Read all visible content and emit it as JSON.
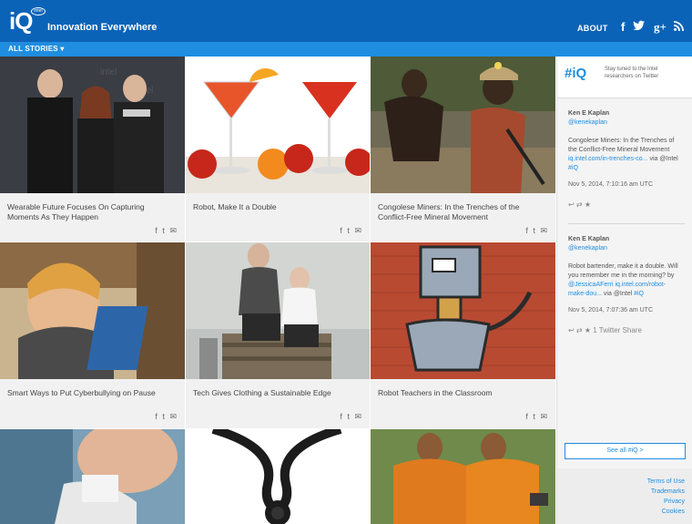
{
  "header": {
    "logo_text": "iQ",
    "logo_badge": "intel",
    "tagline": "Innovation Everywhere",
    "about_label": "ABOUT",
    "social": {
      "facebook": "f",
      "twitter": "t",
      "google": "g+",
      "rss": "rss"
    },
    "all_stories_label": "ALL STORIES ▾"
  },
  "stories": [
    {
      "title": "Wearable Future Focuses On Capturing Moments As They Happen"
    },
    {
      "title": "Robot, Make It a Double"
    },
    {
      "title": "Congolese Miners: In the Trenches of the Conflict-Free Mineral Movement"
    },
    {
      "title": "Smart Ways to Put Cyberbullying on Pause"
    },
    {
      "title": "Tech Gives Clothing a Sustainable Edge"
    },
    {
      "title": "Robot Teachers in the Classroom"
    }
  ],
  "share_icons": [
    "f",
    "t",
    "✉"
  ],
  "sidebar": {
    "brand": "#iQ",
    "tagline": "Stay tuned to the Intel researchers on Twitter",
    "tweets": [
      {
        "author": "Ken E Kaplan",
        "handle": "@kenekaplan",
        "text": "Congolese Miners: In the Trenches of the Conflict-Free Mineral Movement",
        "link": "iq.intel.com/in-trenches-co...",
        "via": "via @Intel",
        "hashtag": "#iQ",
        "time": "Nov 5, 2014, 7:10:16 am UTC",
        "actions": "↩ ⇄ ★"
      },
      {
        "author": "Ken E Kaplan",
        "handle": "@kenekaplan",
        "text": "Robot bartender, make it a double. Will you remember me in the morning? by",
        "mention": "@JessicaAFerri",
        "link": "iq.intel.com/robot-make-dou...",
        "via": "via @Intel",
        "hashtag": "#iQ",
        "time": "Nov 5, 2014, 7:07:36 am UTC",
        "actions": "↩ ⇄ ★ 1 Twitter Share"
      }
    ],
    "see_all_label": "See all #iQ >",
    "footer": [
      "Terms of Use",
      "Trademarks",
      "Privacy",
      "Cookies"
    ]
  }
}
